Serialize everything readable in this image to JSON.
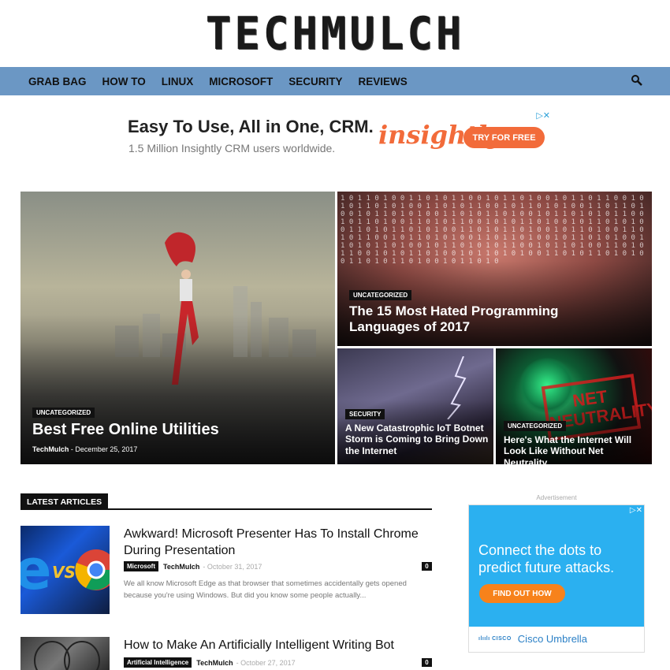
{
  "site": {
    "logo": "TECHMULCH"
  },
  "nav": {
    "items": [
      "GRAB BAG",
      "HOW TO",
      "LINUX",
      "MICROSOFT",
      "SECURITY",
      "REVIEWS"
    ]
  },
  "top_ad": {
    "headline": "Easy To Use, All in One, CRM.",
    "sub": "1.5 Million Insightly CRM users worldwide.",
    "brand": "insightly",
    "cta": "TRY FOR FREE",
    "adchoice": "▷✕"
  },
  "featured": [
    {
      "category": "UNCATEGORIZED",
      "title": "Best Free Online Utilities",
      "author": "TechMulch",
      "separator": "-",
      "date": "December 25, 2017"
    },
    {
      "category": "UNCATEGORIZED",
      "title": "The 15 Most Hated Programming Languages of 2017"
    },
    {
      "category": "SECURITY",
      "title": "A New Catastrophic IoT Botnet Storm is Coming to Bring Down the Internet"
    },
    {
      "category": "UNCATEGORIZED",
      "title": "Here's What the Internet Will Look Like Without Net Neutrality",
      "image_text": "NET NEUTRALITY"
    }
  ],
  "latest": {
    "heading": "LATEST ARTICLES",
    "articles": [
      {
        "title": "Awkward! Microsoft Presenter Has To Install Chrome During Presentation",
        "tag": "Microsoft",
        "author": "TechMulch",
        "separator": "-",
        "date": "October 31, 2017",
        "comments": "0",
        "excerpt": "We all know Microsoft Edge as that browser that sometimes accidentally gets opened because you're using Windows. But did you know some people actually...",
        "thumb_text": "VS"
      },
      {
        "title": "How to Make An Artificially Intelligent Writing Bot",
        "tag": "Artificial Intelligence",
        "author": "TechMulch",
        "separator": "-",
        "date": "October 27, 2017",
        "comments": "0"
      }
    ]
  },
  "side_ad": {
    "label": "Advertisement",
    "headline": "Connect the dots to predict future attacks.",
    "cta": "FIND OUT HOW",
    "cisco_text": "ılıılı CISCO",
    "footer": "Cisco Umbrella",
    "adchoice": "▷✕"
  },
  "colors": {
    "nav": "#6b97c4",
    "accent_orange": "#f26b3a",
    "ad_blue": "#2bb0f0"
  }
}
